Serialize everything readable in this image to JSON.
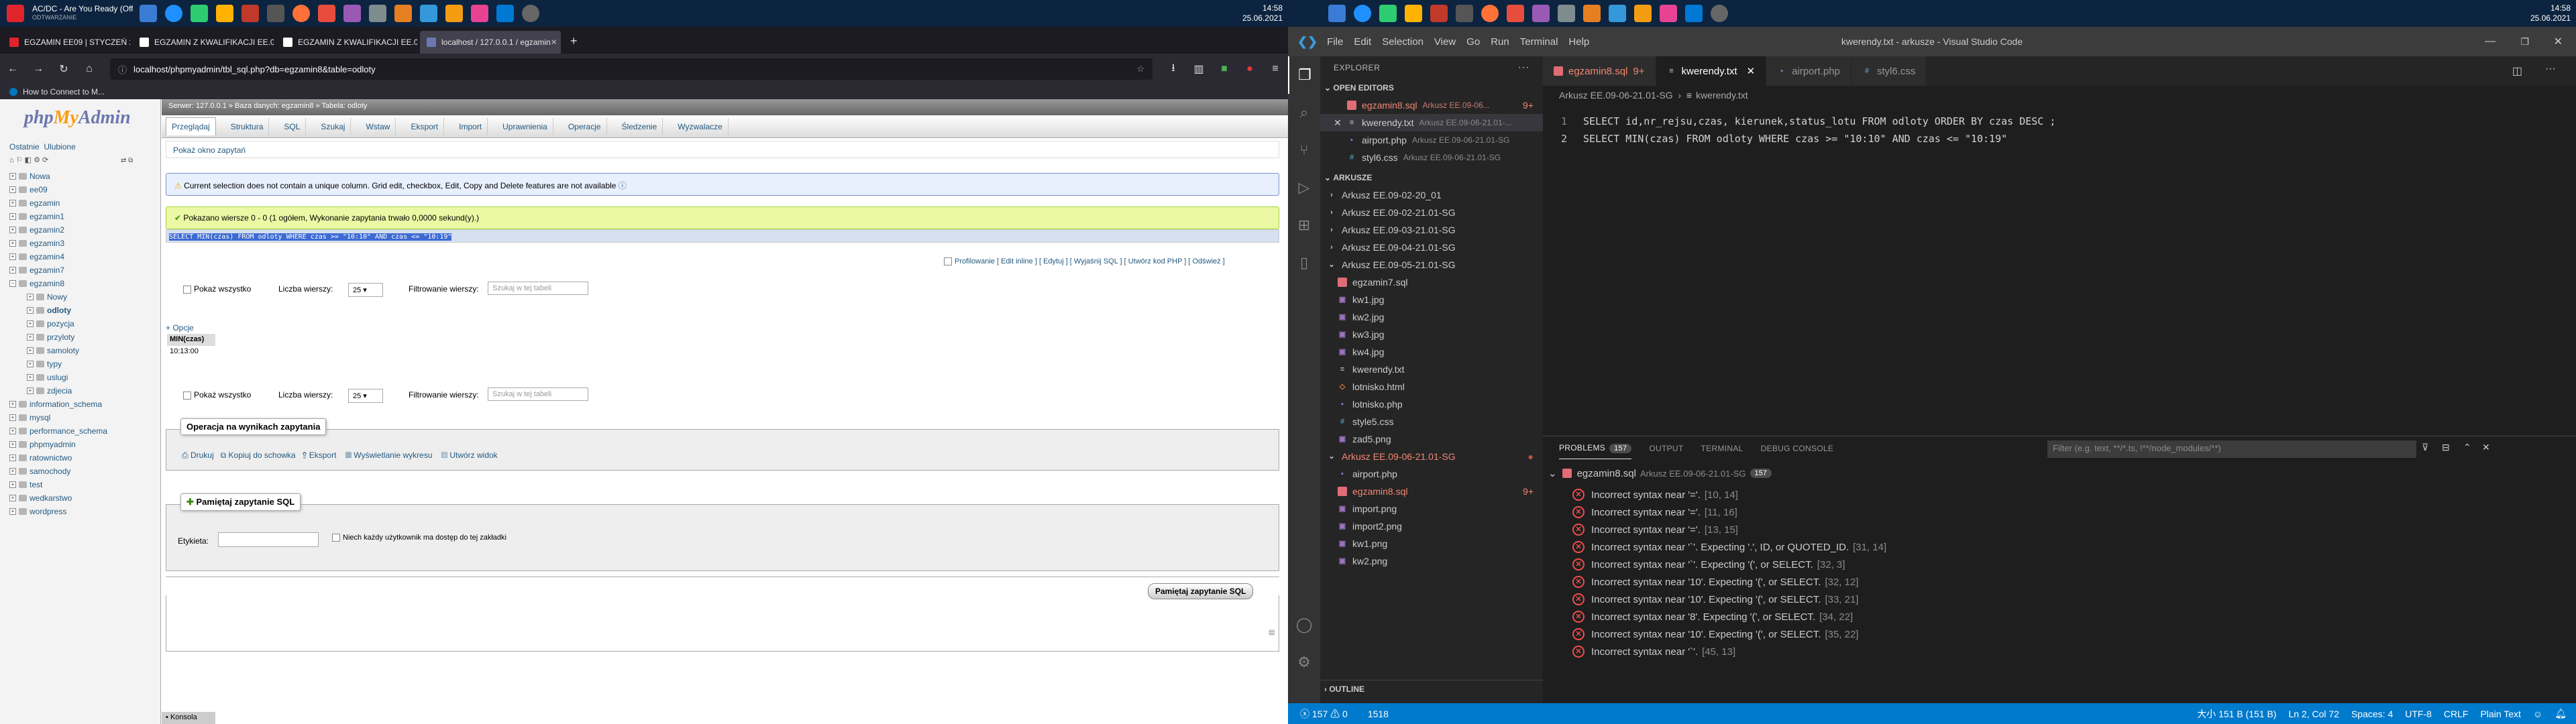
{
  "left_taskbar": {
    "title_line1": "AC/DC - Are You Ready (Offici...",
    "title_line2": "ODTWARZANIE",
    "time": "14:58",
    "date": "25.06.2021"
  },
  "firefox": {
    "tabs": [
      {
        "label": "EGZAMIN EE09 | STYCZEŃ 2021",
        "active": false
      },
      {
        "label": "EGZAMIN Z KWALIFIKACJI EE.09",
        "active": false
      },
      {
        "label": "EGZAMIN Z KWALIFIKACJI EE.09",
        "active": false
      },
      {
        "label": "localhost / 127.0.0.1 / egzamin",
        "active": true
      }
    ],
    "url": "localhost/phpmyadmin/tbl_sql.php?db=egzamin8&table=odloty",
    "bookmark": "How to Connect to M..."
  },
  "pma": {
    "logo_main": "phpMyAdmin",
    "recent": "Ostatnie",
    "favorites": "Ulubione",
    "tree": [
      {
        "name": "Nowa",
        "level": 0
      },
      {
        "name": "ee09",
        "level": 0
      },
      {
        "name": "egzamin",
        "level": 0
      },
      {
        "name": "egzamin1",
        "level": 0
      },
      {
        "name": "egzamin2",
        "level": 0
      },
      {
        "name": "egzamin3",
        "level": 0
      },
      {
        "name": "egzamin4",
        "level": 0
      },
      {
        "name": "egzamin7",
        "level": 0
      },
      {
        "name": "egzamin8",
        "level": 0
      },
      {
        "name": "Nowy",
        "level": 1
      },
      {
        "name": "odloty",
        "level": 1
      },
      {
        "name": "pozycja",
        "level": 1
      },
      {
        "name": "przyloty",
        "level": 1
      },
      {
        "name": "samoloty",
        "level": 1
      },
      {
        "name": "typy",
        "level": 1
      },
      {
        "name": "uslugi",
        "level": 1
      },
      {
        "name": "zdjecia",
        "level": 1
      },
      {
        "name": "information_schema",
        "level": 0
      },
      {
        "name": "mysql",
        "level": 0
      },
      {
        "name": "performance_schema",
        "level": 0
      },
      {
        "name": "phpmyadmin",
        "level": 0
      },
      {
        "name": "ratownictwo",
        "level": 0
      },
      {
        "name": "samochody",
        "level": 0
      },
      {
        "name": "test",
        "level": 0
      },
      {
        "name": "wedkarstwo",
        "level": 0
      },
      {
        "name": "wordpress",
        "level": 0
      }
    ],
    "breadcrumb": "Serwer: 127.0.0.1 » Baza danych: egzamin8 » Tabela: odloty",
    "menu": [
      "Przeglądaj",
      "Struktura",
      "SQL",
      "Szukaj",
      "Wstaw",
      "Eksport",
      "Import",
      "Uprawnienia",
      "Operacje",
      "Śledzenie",
      "Wyzwalacze"
    ],
    "show_query_box": "Pokaż okno zapytań",
    "notice": "Current selection does not contain a unique column. Grid edit, checkbox, Edit, Copy and Delete features are not available",
    "success": "Pokazano wiersze 0 - 0 (1 ogółem, Wykonanie zapytania trwało 0,0000 sekund(y).)",
    "query": "SELECT MIN(czas) FROM odloty WHERE czas >= \"10:10\" AND czas <= \"10:19\"",
    "profiling_links": "Profilowanie [ Edit inline ] [ Edytuj ] [ Wyjaśnij SQL ] [ Utwórz kod PHP ] [ Odśwież ]",
    "show_all": "Pokaż wszystko",
    "rows_label": "Liczba wierszy:",
    "rows_value": "25",
    "filter_label": "Filtrowanie wierszy:",
    "filter_placeholder": "Szukaj w tej tabeli",
    "options": "+ Opcje",
    "result_header": "MIN(czas)",
    "result_value": "10:13:00",
    "ops_legend": "Operacja na wynikach zapytania",
    "ops": [
      "Drukuj",
      "Kopiuj do schowka",
      "Eksport",
      "Wyświetlanie wykresu",
      "Utwórz widok"
    ],
    "bookmark_legend": "Pamiętaj zapytanie SQL",
    "label_field": "Etykieta:",
    "all_users": "Niech każdy użytkownik ma dostęp do tej zakładki",
    "bookmark_button": "Pamiętaj zapytanie SQL",
    "console": "Konsola"
  },
  "right_taskbar": {
    "time": "14:58",
    "date": "25.06.2021"
  },
  "vscode": {
    "menu": [
      "File",
      "Edit",
      "Selection",
      "View",
      "Go",
      "Run",
      "Terminal",
      "Help"
    ],
    "window_title": "kwerendy.txt - arkusze - Visual Studio Code",
    "explorer_title": "EXPLORER",
    "open_editors_title": "OPEN EDITORS",
    "open_editors": [
      {
        "name": "egzamin8.sql",
        "dir": "Arkusz EE.09-06...",
        "badge": "9+",
        "type": "sql",
        "error": true
      },
      {
        "name": "kwerendy.txt",
        "dir": "Arkusz EE.09-06-21.01-...",
        "badge": "",
        "type": "txt",
        "error": false
      },
      {
        "name": "airport.php",
        "dir": "Arkusz EE.09-06-21.01-SG",
        "badge": "",
        "type": "php",
        "error": false
      },
      {
        "name": "styl6.css",
        "dir": "Arkusz EE.09-06-21.01-SG",
        "badge": "",
        "type": "css",
        "error": false
      }
    ],
    "workspace_title": "ARKUSZE",
    "tree": [
      {
        "name": "Arkusz EE.09-02-20_01",
        "kind": "folder-closed",
        "indent": 1
      },
      {
        "name": "Arkusz EE.09-02-21.01-SG",
        "kind": "folder-closed",
        "indent": 1
      },
      {
        "name": "Arkusz EE.09-03-21.01-SG",
        "kind": "folder-closed",
        "indent": 1
      },
      {
        "name": "Arkusz EE.09-04-21.01-SG",
        "kind": "folder-closed",
        "indent": 1
      },
      {
        "name": "Arkusz EE.09-05-21.01-SG",
        "kind": "folder-open",
        "indent": 1
      },
      {
        "name": "egzamin7.sql",
        "kind": "sql",
        "indent": 2
      },
      {
        "name": "kw1.jpg",
        "kind": "img",
        "indent": 2
      },
      {
        "name": "kw2.jpg",
        "kind": "img",
        "indent": 2
      },
      {
        "name": "kw3.jpg",
        "kind": "img",
        "indent": 2
      },
      {
        "name": "kw4.jpg",
        "kind": "img",
        "indent": 2
      },
      {
        "name": "kwerendy.txt",
        "kind": "txt",
        "indent": 2
      },
      {
        "name": "lotnisko.html",
        "kind": "html",
        "indent": 2
      },
      {
        "name": "lotnisko.php",
        "kind": "php",
        "indent": 2
      },
      {
        "name": "style5.css",
        "kind": "css",
        "indent": 2
      },
      {
        "name": "zad5.png",
        "kind": "img",
        "indent": 2
      },
      {
        "name": "Arkusz EE.09-06-21.01-SG",
        "kind": "folder-open-error",
        "indent": 1
      },
      {
        "name": "airport.php",
        "kind": "php",
        "indent": 2
      },
      {
        "name": "egzamin8.sql",
        "kind": "sql-error",
        "indent": 2
      },
      {
        "name": "import.png",
        "kind": "img",
        "indent": 2
      },
      {
        "name": "import2.png",
        "kind": "img",
        "indent": 2
      },
      {
        "name": "kw1.png",
        "kind": "img",
        "indent": 2
      },
      {
        "name": "kw2.png",
        "kind": "img",
        "indent": 2
      }
    ],
    "outline_title": "OUTLINE",
    "tabs": [
      {
        "name": "egzamin8.sql",
        "badge": "9+",
        "type": "sql",
        "active": false
      },
      {
        "name": "kwerendy.txt",
        "badge": "",
        "type": "txt",
        "active": true
      },
      {
        "name": "airport.php",
        "badge": "",
        "type": "php",
        "active": false
      },
      {
        "name": "styl6.css",
        "badge": "",
        "type": "css",
        "active": false
      }
    ],
    "breadcrumb": [
      "Arkusz EE.09-06-21.01-SG",
      "kwerendy.txt"
    ],
    "code_lines": [
      "SELECT id,nr_rejsu,czas, kierunek,status_lotu FROM odloty ORDER BY czas DESC ;",
      "SELECT MIN(czas) FROM odloty WHERE czas >= \"10:10\" AND czas <= \"10:19\""
    ],
    "panel_tabs": [
      "PROBLEMS",
      "OUTPUT",
      "TERMINAL",
      "DEBUG CONSOLE"
    ],
    "problems_count": "157",
    "filter_placeholder": "Filter (e.g. text, **/*.ts, !**/node_modules/**)",
    "problem_file": "egzamin8.sql",
    "problem_dir": "Arkusz EE.09-06-21.01-SG",
    "problem_file_count": "157",
    "problems": [
      {
        "msg": "Incorrect syntax near '='.",
        "loc": "[10, 14]"
      },
      {
        "msg": "Incorrect syntax near '='.",
        "loc": "[11, 16]"
      },
      {
        "msg": "Incorrect syntax near '='.",
        "loc": "[13, 15]"
      },
      {
        "msg": "Incorrect syntax near '`'. Expecting '.', ID, or QUOTED_ID.",
        "loc": "[31, 14]"
      },
      {
        "msg": "Incorrect syntax near '`'. Expecting '(', or SELECT.",
        "loc": "[32, 3]"
      },
      {
        "msg": "Incorrect syntax near '10'. Expecting '(', or SELECT.",
        "loc": "[32, 12]"
      },
      {
        "msg": "Incorrect syntax near '10'. Expecting '(', or SELECT.",
        "loc": "[33, 21]"
      },
      {
        "msg": "Incorrect syntax near '8'. Expecting '(', or SELECT.",
        "loc": "[34, 22]"
      },
      {
        "msg": "Incorrect syntax near '10'. Expecting '(', or SELECT.",
        "loc": "[35, 22]"
      },
      {
        "msg": "Incorrect syntax near '`'.",
        "loc": "[45, 13]"
      }
    ],
    "status": {
      "errors": "157",
      "warnings": "0",
      "number": "1518",
      "size": "大小 151 B (151 B)",
      "position": "Ln 2, Col 72",
      "spaces": "Spaces: 4",
      "encoding": "UTF-8",
      "eol": "CRLF",
      "language": "Plain Text"
    }
  }
}
